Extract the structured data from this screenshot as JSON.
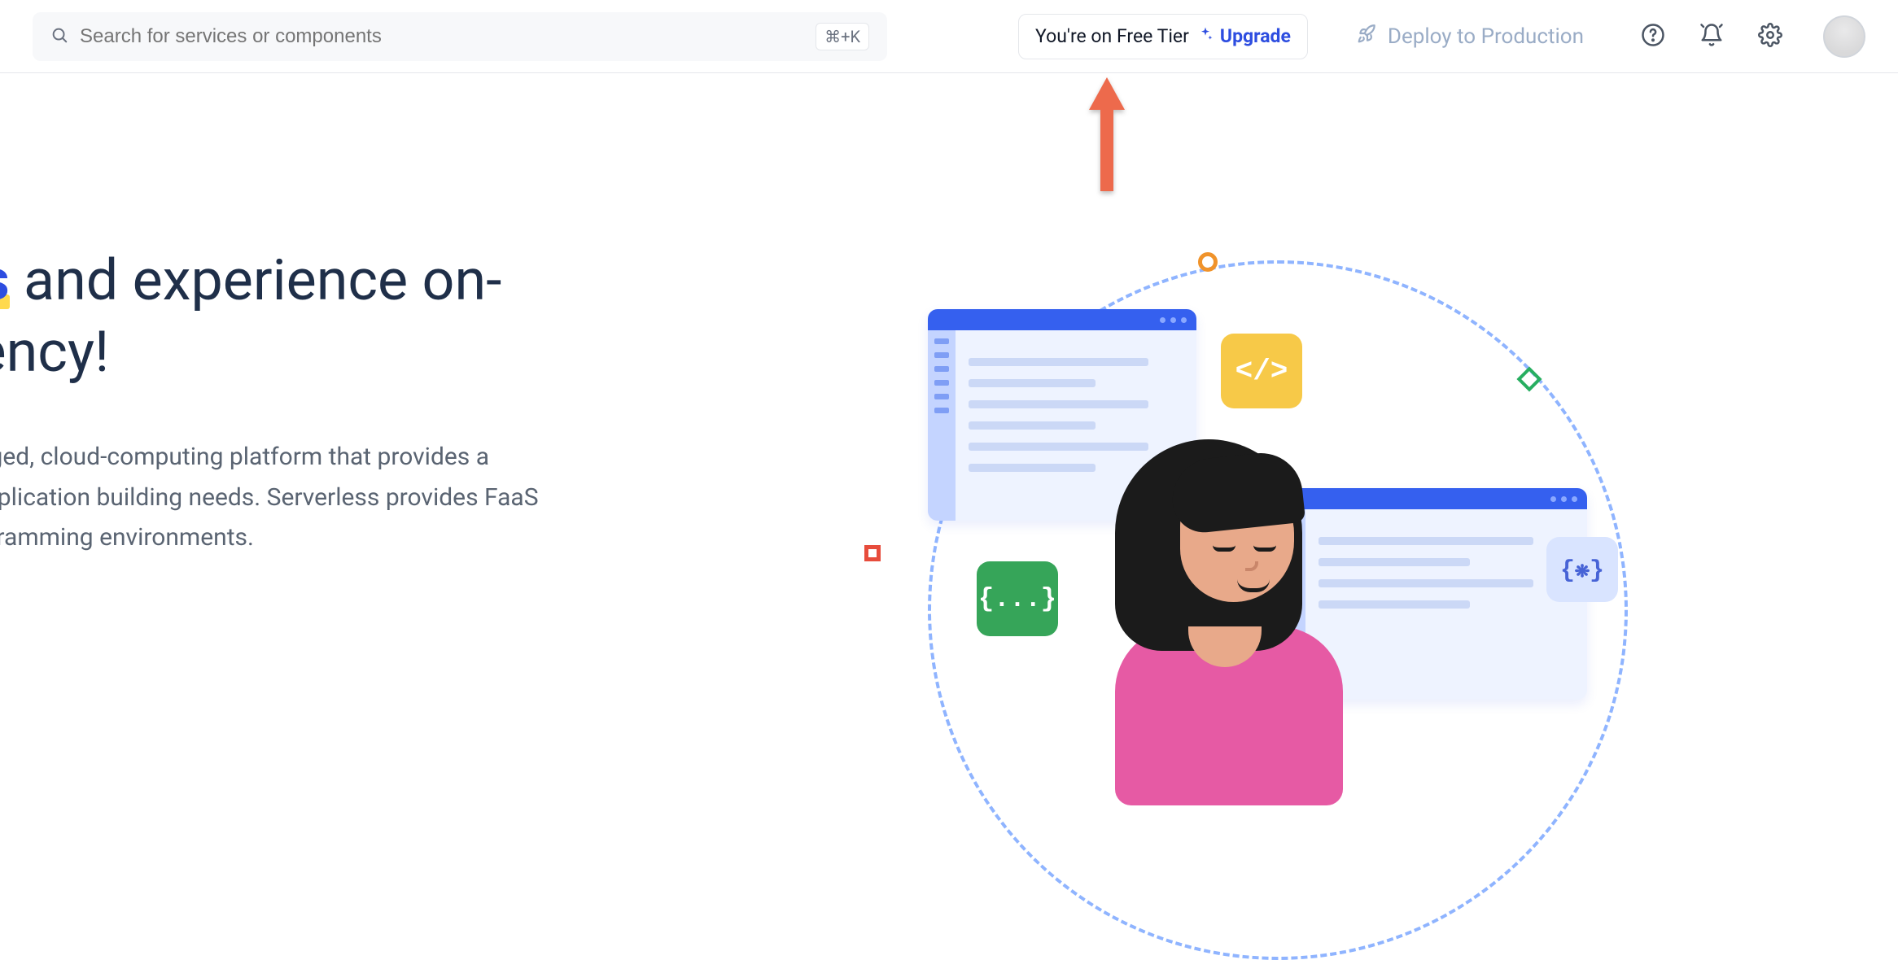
{
  "header": {
    "search_placeholder": "Search for services or components",
    "search_shortcut": "⌘+K",
    "tier_text": "You're on Free Tier",
    "upgrade_label": "Upgrade",
    "deploy_label": "Deploy to Production"
  },
  "hero": {
    "crumb_tail": "s",
    "title_highlight": "erless",
    "title_rest_1": " and experience on-",
    "title_line2": " efficiency!",
    "desc_line1": "'s fully-managed, cloud-computing platform that provides a",
    "desc_line2": "re for your application building needs. Serverless provides FaaS",
    "desc_line3": " multiple programming environments."
  },
  "chips": {
    "code": "</>",
    "json": "{...}",
    "brace": "{❋}"
  }
}
